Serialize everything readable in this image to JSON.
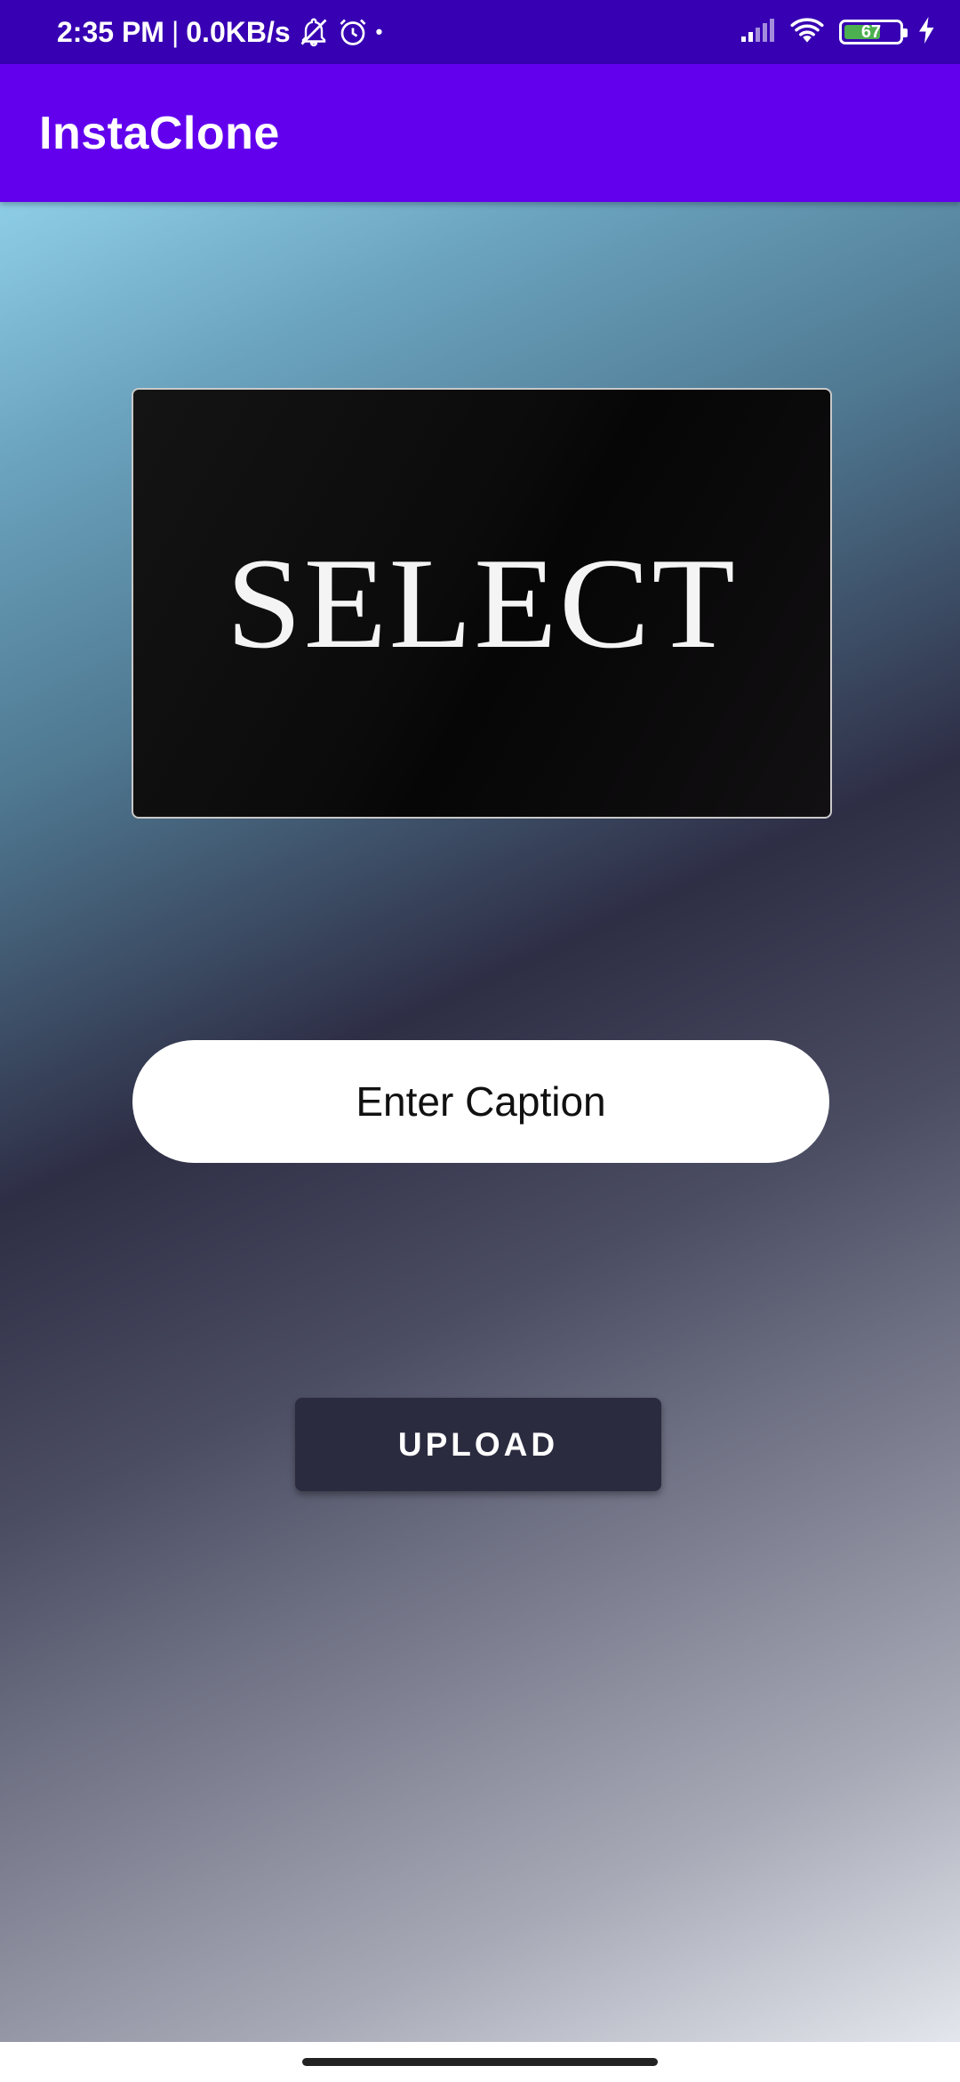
{
  "status_bar": {
    "time": "2:35 PM",
    "separator": "|",
    "network_speed": "0.0KB/s",
    "dot": "•",
    "battery_level": "67",
    "battery_fraction": 0.67,
    "icons": [
      "notifications-off-icon",
      "alarm-icon",
      "signal-icon",
      "wifi-icon",
      "battery-icon",
      "charging-icon"
    ]
  },
  "app_bar": {
    "title": "InstaClone",
    "color": "#6200ee"
  },
  "main": {
    "image_placeholder_text": "SELECT",
    "caption_placeholder": "Enter Caption",
    "caption_value": "",
    "upload_label": "UPLOAD"
  },
  "colors": {
    "status_bar": "#3700b3",
    "primary": "#6200ee",
    "button": "#2b2b40"
  }
}
